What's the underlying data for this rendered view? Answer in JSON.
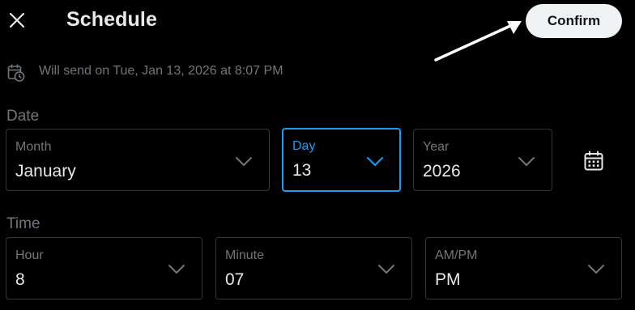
{
  "header": {
    "title": "Schedule",
    "confirm_label": "Confirm"
  },
  "notice": {
    "text": "Will send on Tue, Jan 13, 2026 at 8:07 PM"
  },
  "date_section": {
    "label": "Date",
    "month": {
      "label": "Month",
      "value": "January"
    },
    "day": {
      "label": "Day",
      "value": "13"
    },
    "year": {
      "label": "Year",
      "value": "2026"
    }
  },
  "time_section": {
    "label": "Time",
    "hour": {
      "label": "Hour",
      "value": "8"
    },
    "minute": {
      "label": "Minute",
      "value": "07"
    },
    "ampm": {
      "label": "AM/PM",
      "value": "PM"
    }
  },
  "icons": {
    "close": "close-icon",
    "schedule": "calendar-clock-icon",
    "chevron": "chevron-down-icon",
    "calendar": "calendar-icon"
  },
  "colors": {
    "background": "#000000",
    "text": "#e7e9ea",
    "muted": "#71767b",
    "accent": "#1d9bf0",
    "border": "#333639",
    "confirm_bg": "#eff3f4"
  }
}
